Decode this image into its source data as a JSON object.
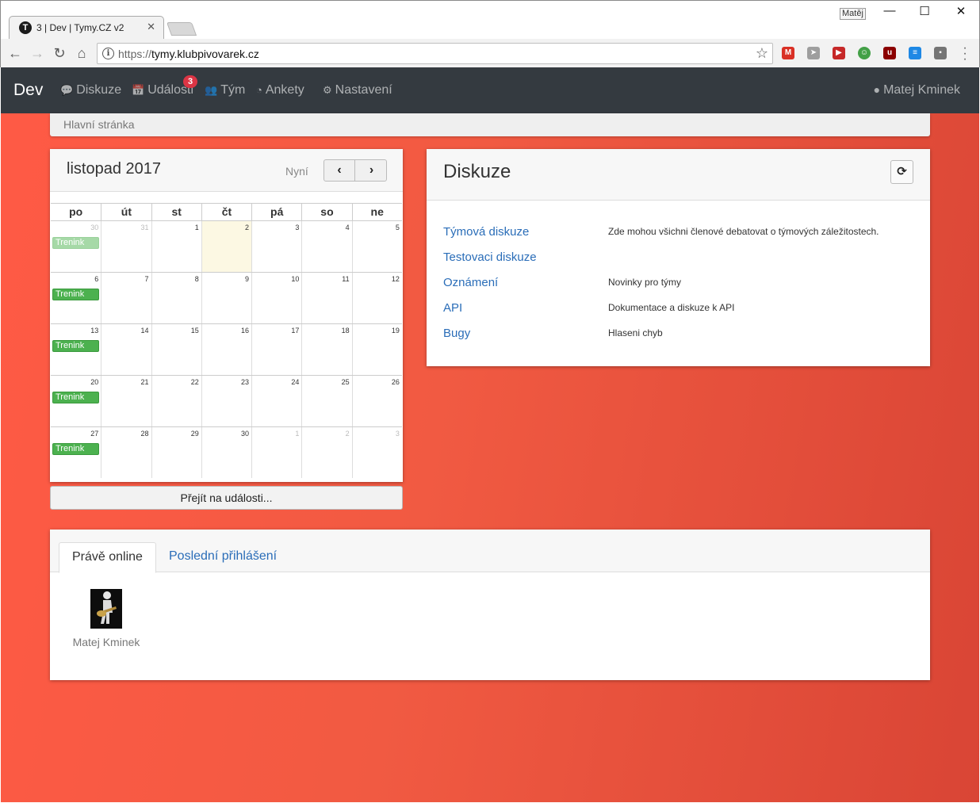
{
  "browser": {
    "tab_title": "3 | Dev | Tymy.CZ v2",
    "tab_favicon": "T",
    "profile_name": "Matěj",
    "url_scheme": "https://",
    "url_host": "tymy.klubpivovarek.cz"
  },
  "nav": {
    "brand": "Dev",
    "items": [
      {
        "label": "Diskuze",
        "icon": "comments-icon"
      },
      {
        "label": "Události",
        "icon": "calendar-icon",
        "badge": "3"
      },
      {
        "label": "Tým",
        "icon": "users-icon"
      },
      {
        "label": "Ankety",
        "icon": "pie-chart-icon"
      },
      {
        "label": "Nastavení",
        "icon": "gears-icon"
      }
    ],
    "user": "Matej Kminek"
  },
  "breadcrumb": "Hlavní stránka",
  "calendar": {
    "month": "listopad 2017",
    "now_label": "Nyní",
    "days_of_week": [
      "po",
      "út",
      "st",
      "čt",
      "pá",
      "so",
      "ne"
    ],
    "weeks": [
      [
        {
          "n": "30",
          "other": true,
          "event": "Trenink"
        },
        {
          "n": "31",
          "other": true
        },
        {
          "n": "1"
        },
        {
          "n": "2",
          "today": true
        },
        {
          "n": "3"
        },
        {
          "n": "4"
        },
        {
          "n": "5"
        }
      ],
      [
        {
          "n": "6",
          "event": "Trenink"
        },
        {
          "n": "7"
        },
        {
          "n": "8"
        },
        {
          "n": "9"
        },
        {
          "n": "10"
        },
        {
          "n": "11"
        },
        {
          "n": "12"
        }
      ],
      [
        {
          "n": "13",
          "event": "Trenink"
        },
        {
          "n": "14"
        },
        {
          "n": "15"
        },
        {
          "n": "16"
        },
        {
          "n": "17"
        },
        {
          "n": "18"
        },
        {
          "n": "19"
        }
      ],
      [
        {
          "n": "20",
          "event": "Trenink"
        },
        {
          "n": "21"
        },
        {
          "n": "22"
        },
        {
          "n": "23"
        },
        {
          "n": "24"
        },
        {
          "n": "25"
        },
        {
          "n": "26"
        }
      ],
      [
        {
          "n": "27",
          "event": "Trenink"
        },
        {
          "n": "28"
        },
        {
          "n": "29"
        },
        {
          "n": "30"
        },
        {
          "n": "1",
          "other": true
        },
        {
          "n": "2",
          "other": true
        },
        {
          "n": "3",
          "other": true
        }
      ]
    ],
    "footer_button": "Přejít na události..."
  },
  "discussions": {
    "title": "Diskuze",
    "items": [
      {
        "name": "Týmová diskuze",
        "desc": "Zde mohou všichni členové debatovat o týmových záležitostech."
      },
      {
        "name": "Testovaci diskuze",
        "desc": ""
      },
      {
        "name": "Oznámení",
        "desc": "Novinky pro týmy"
      },
      {
        "name": "API",
        "desc": "Dokumentace a diskuze k API"
      },
      {
        "name": "Bugy",
        "desc": "Hlaseni chyb"
      }
    ]
  },
  "online": {
    "tab_active": "Právě online",
    "tab_other": "Poslední přihlášení",
    "users": [
      {
        "name": "Matej Kminek"
      }
    ]
  }
}
